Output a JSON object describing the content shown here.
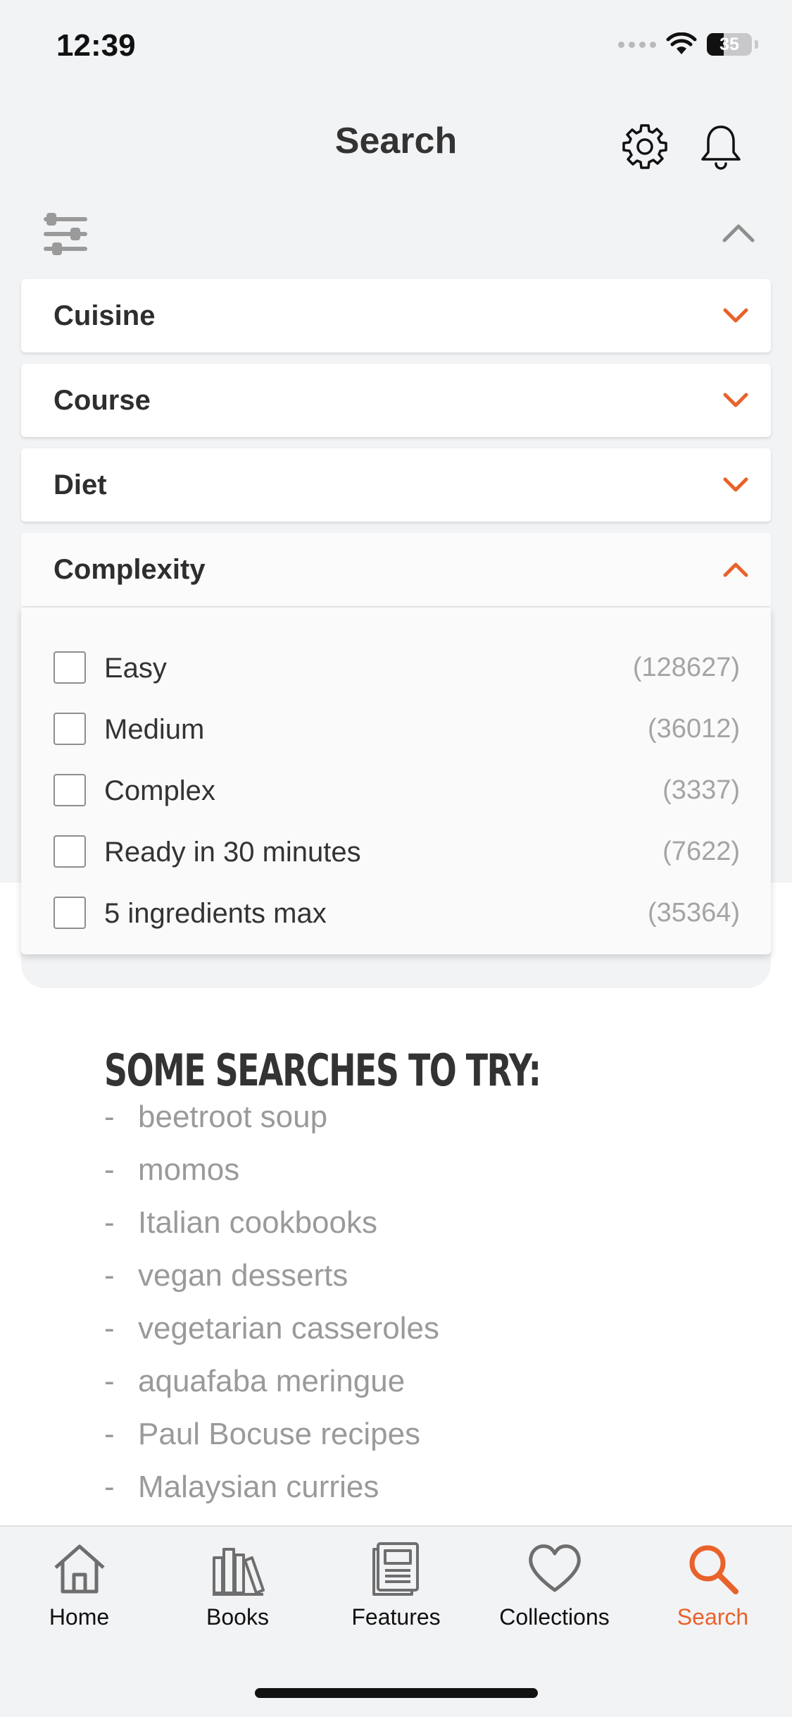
{
  "status_bar": {
    "time": "12:39",
    "battery": "35"
  },
  "header": {
    "title": "Search"
  },
  "filters": [
    {
      "label": "Cuisine",
      "expanded": false
    },
    {
      "label": "Course",
      "expanded": false
    },
    {
      "label": "Diet",
      "expanded": false
    },
    {
      "label": "Complexity",
      "expanded": true
    }
  ],
  "complexity_options": [
    {
      "label": "Easy",
      "count": "(128627)",
      "checked": false
    },
    {
      "label": "Medium",
      "count": "(36012)",
      "checked": false
    },
    {
      "label": "Complex",
      "count": "(3337)",
      "checked": false
    },
    {
      "label": "Ready in 30 minutes",
      "count": "(7622)",
      "checked": false
    },
    {
      "label": "5 ingredients max",
      "count": "(35364)",
      "checked": false
    }
  ],
  "suggestions": {
    "title": "SOME SEARCHES TO TRY:",
    "bullet": "-",
    "items": [
      "beetroot soup",
      "momos",
      "Italian cookbooks",
      "vegan desserts",
      "vegetarian casseroles",
      "aquafaba meringue",
      "Paul Bocuse recipes",
      "Malaysian curries"
    ]
  },
  "tabbar": {
    "items": [
      {
        "label": "Home",
        "icon": "home-icon"
      },
      {
        "label": "Books",
        "icon": "books-icon"
      },
      {
        "label": "Features",
        "icon": "features-icon"
      },
      {
        "label": "Collections",
        "icon": "heart-icon"
      },
      {
        "label": "Search",
        "icon": "search-icon",
        "active": true
      }
    ]
  },
  "colors": {
    "accent": "#e8622a",
    "background": "#f2f3f5",
    "text": "#333333",
    "muted": "#9a9a9a"
  }
}
